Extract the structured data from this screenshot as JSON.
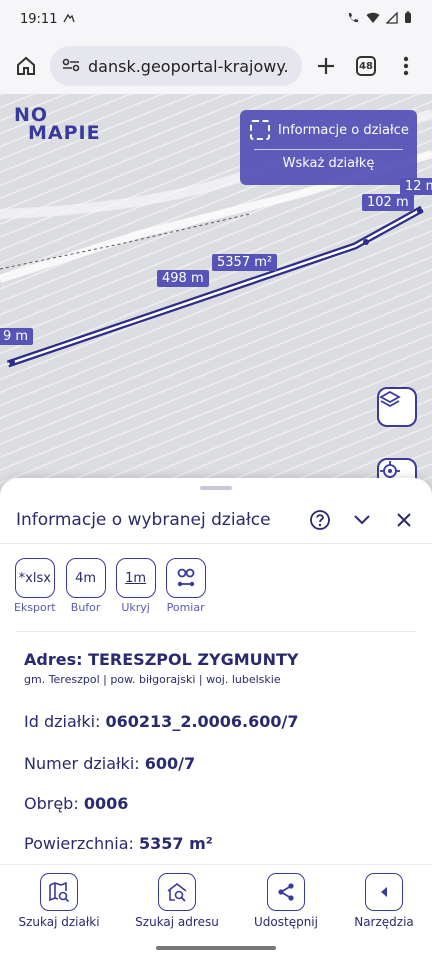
{
  "status": {
    "time": "19:11"
  },
  "browser": {
    "url": "dansk.geoportal-krajowy.pl",
    "tab_count": "48"
  },
  "map": {
    "logo_line1": "NO",
    "logo_line2": "MAPIE",
    "info_card": {
      "title": "Informacje o działce",
      "action": "Wskaż działkę"
    },
    "labels": {
      "l102": "102 m",
      "l12": "12 m",
      "l5357": "5357 m²",
      "l498": "498 m",
      "l9": "9 m"
    }
  },
  "sheet": {
    "title": "Informacje o wybranej działce",
    "tools": [
      {
        "icon_text": "*xlsx",
        "label": "Eksport"
      },
      {
        "icon_text": "4m",
        "label": "Bufor"
      },
      {
        "icon_text": "1m",
        "label": "Ukryj"
      },
      {
        "icon_text": "",
        "label": "Pomiar"
      }
    ],
    "address_title": "Adres: TERESZPOL ZYGMUNTY",
    "address_sub": "gm. Tereszpol | pow. biłgorajski | woj. lubelskie",
    "fields": [
      {
        "label": "Id działki:",
        "value": "060213_2.0006.600/7"
      },
      {
        "label": "Numer działki:",
        "value": "600/7"
      },
      {
        "label": "Obręb:",
        "value": "0006"
      },
      {
        "label": "Powierzchnia:",
        "value": "5357 m²"
      }
    ]
  },
  "nav": [
    {
      "label": "Szukaj działki"
    },
    {
      "label": "Szukaj adresu"
    },
    {
      "label": "Udostępnij"
    },
    {
      "label": "Narzędzia"
    }
  ],
  "colors": {
    "accent": "#5754b8",
    "text": "#2a2a6e"
  }
}
